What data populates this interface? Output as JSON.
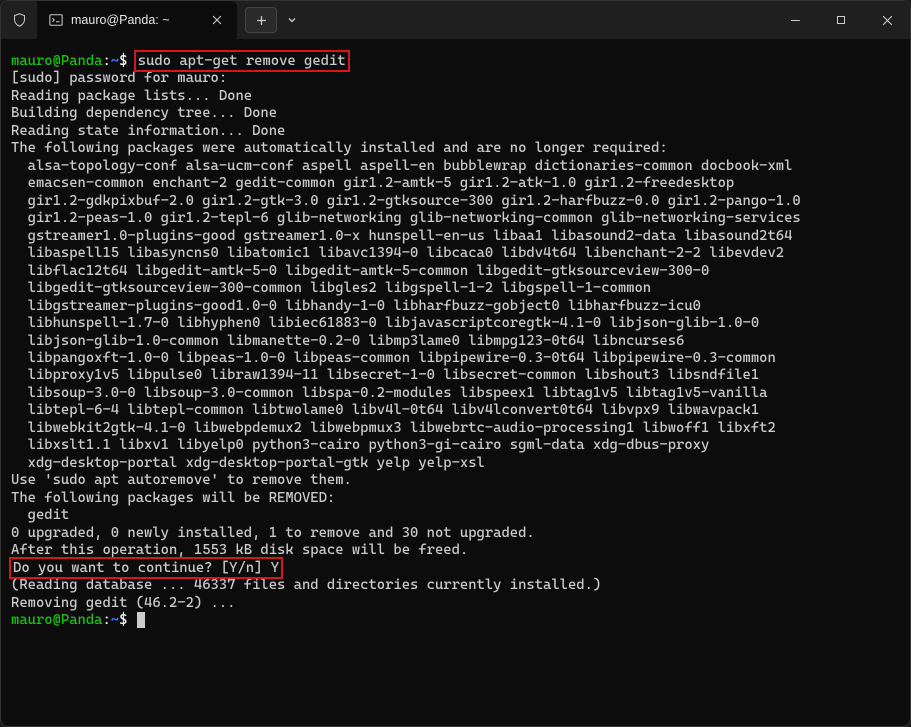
{
  "window": {
    "tab_title": "mauro@Panda: ~"
  },
  "prompt": {
    "user_host": "mauro@Panda",
    "sep": ":",
    "path": "~",
    "dollar": "$"
  },
  "cmd1": "sudo apt-get remove gedit",
  "lines": {
    "l0": "[sudo] password for mauro:",
    "l1": "Reading package lists... Done",
    "l2": "Building dependency tree... Done",
    "l3": "Reading state information... Done",
    "l4": "The following packages were automatically installed and are no longer required:",
    "l5": "  alsa-topology-conf alsa-ucm-conf aspell aspell-en bubblewrap dictionaries-common docbook-xml",
    "l6": "  emacsen-common enchant-2 gedit-common gir1.2-amtk-5 gir1.2-atk-1.0 gir1.2-freedesktop",
    "l7": "  gir1.2-gdkpixbuf-2.0 gir1.2-gtk-3.0 gir1.2-gtksource-300 gir1.2-harfbuzz-0.0 gir1.2-pango-1.0",
    "l8": "  gir1.2-peas-1.0 gir1.2-tepl-6 glib-networking glib-networking-common glib-networking-services",
    "l9": "  gstreamer1.0-plugins-good gstreamer1.0-x hunspell-en-us libaa1 libasound2-data libasound2t64",
    "l10": "  libaspell15 libasyncns0 libatomic1 libavc1394-0 libcaca0 libdv4t64 libenchant-2-2 libevdev2",
    "l11": "  libflac12t64 libgedit-amtk-5-0 libgedit-amtk-5-common libgedit-gtksourceview-300-0",
    "l12": "  libgedit-gtksourceview-300-common libgles2 libgspell-1-2 libgspell-1-common",
    "l13": "  libgstreamer-plugins-good1.0-0 libhandy-1-0 libharfbuzz-gobject0 libharfbuzz-icu0",
    "l14": "  libhunspell-1.7-0 libhyphen0 libiec61883-0 libjavascriptcoregtk-4.1-0 libjson-glib-1.0-0",
    "l15": "  libjson-glib-1.0-common libmanette-0.2-0 libmp3lame0 libmpg123-0t64 libncurses6",
    "l16": "  libpangoxft-1.0-0 libpeas-1.0-0 libpeas-common libpipewire-0.3-0t64 libpipewire-0.3-common",
    "l17": "  libproxy1v5 libpulse0 libraw1394-11 libsecret-1-0 libsecret-common libshout3 libsndfile1",
    "l18": "  libsoup-3.0-0 libsoup-3.0-common libspa-0.2-modules libspeex1 libtag1v5 libtag1v5-vanilla",
    "l19": "  libtepl-6-4 libtepl-common libtwolame0 libv4l-0t64 libv4lconvert0t64 libvpx9 libwavpack1",
    "l20": "  libwebkit2gtk-4.1-0 libwebpdemux2 libwebpmux3 libwebrtc-audio-processing1 libwoff1 libxft2",
    "l21": "  libxslt1.1 libxv1 libyelp0 python3-cairo python3-gi-cairo sgml-data xdg-dbus-proxy",
    "l22": "  xdg-desktop-portal xdg-desktop-portal-gtk yelp yelp-xsl",
    "l23": "Use 'sudo apt autoremove' to remove them.",
    "l24": "The following packages will be REMOVED:",
    "l25": "  gedit",
    "l26": "0 upgraded, 0 newly installed, 1 to remove and 30 not upgraded.",
    "l27": "After this operation, 1553 kB disk space will be freed.",
    "l28": "Do you want to continue? [Y/n] Y",
    "l29": "(Reading database ... 46337 files and directories currently installed.)",
    "l30": "Removing gedit (46.2-2) ..."
  }
}
